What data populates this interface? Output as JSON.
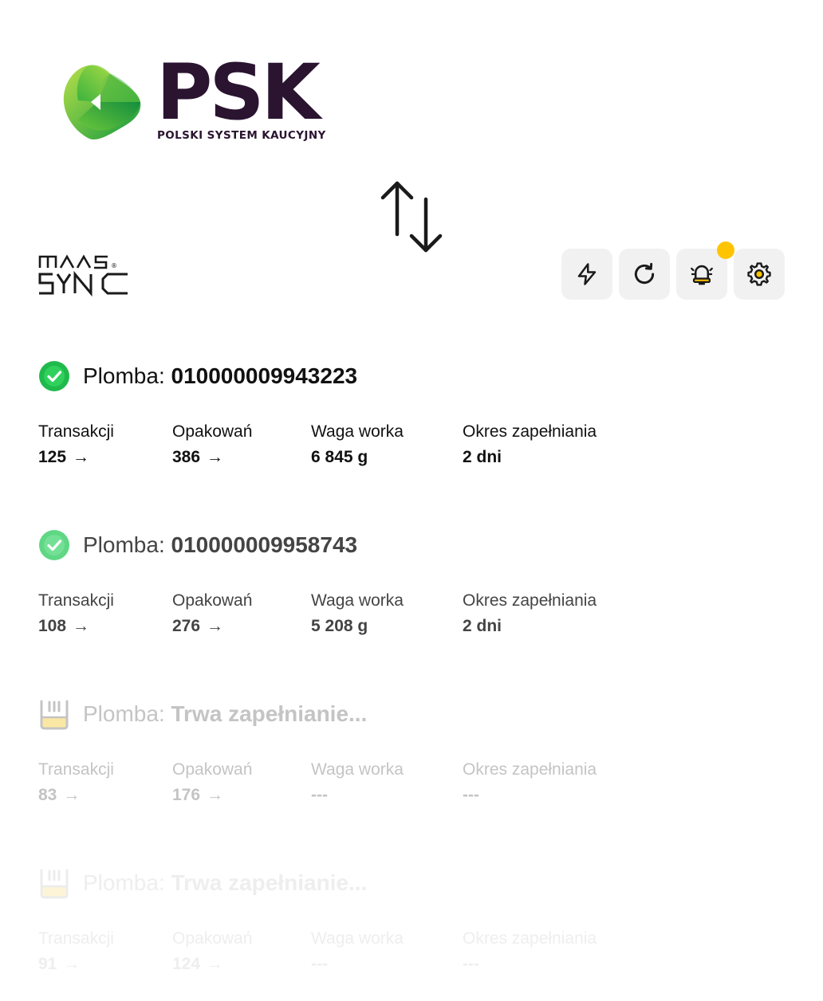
{
  "brand": {
    "psk_name": "PSK",
    "psk_tagline": "POLSKI SYSTEM KAUCYJNY",
    "maas_line1": "MAAS",
    "maas_line2": "SYNC",
    "maas_mark": "®"
  },
  "sync_icon": "sync-arrows-icon",
  "toolbar": {
    "buttons": [
      {
        "icon": "lightning-icon"
      },
      {
        "icon": "refresh-icon"
      },
      {
        "icon": "alarm-bell-icon",
        "has_notification": true
      },
      {
        "icon": "gear-icon"
      }
    ],
    "notification_color": "#ffc400"
  },
  "seal_label": "Plomba:",
  "stat_labels": {
    "transactions": "Transakcji",
    "packages": "Opakowań",
    "bag_weight": "Waga worka",
    "fill_period": "Okres zapełniania"
  },
  "arrow_glyph": "→",
  "seals": [
    {
      "status": "complete",
      "icon": "check-circle-icon",
      "number": "010000009943223",
      "transactions": "125",
      "packages": "386",
      "bag_weight": "6 845 g",
      "fill_period": "2 dni"
    },
    {
      "status": "complete",
      "icon": "check-circle-icon",
      "number": "010000009958743",
      "transactions": "108",
      "packages": "276",
      "bag_weight": "5 208 g",
      "fill_period": "2 dni"
    },
    {
      "status": "filling",
      "icon": "bin-filling-icon",
      "number": "Trwa zapełnianie...",
      "transactions": "83",
      "packages": "176",
      "bag_weight": "---",
      "fill_period": "---"
    },
    {
      "status": "filling",
      "icon": "bin-filling-icon",
      "number": "Trwa zapełnianie...",
      "transactions": "91",
      "packages": "124",
      "bag_weight": "---",
      "fill_period": "---"
    }
  ],
  "colors": {
    "brand_dark": "#2a1430",
    "psk_green_light": "#8dd33a",
    "psk_green_dark": "#0f8a3c",
    "check_green": "#1fba4b",
    "check_green_light": "#5fd784",
    "bin_fill": "#fbe7a4",
    "button_bg": "#f1f1f1"
  }
}
